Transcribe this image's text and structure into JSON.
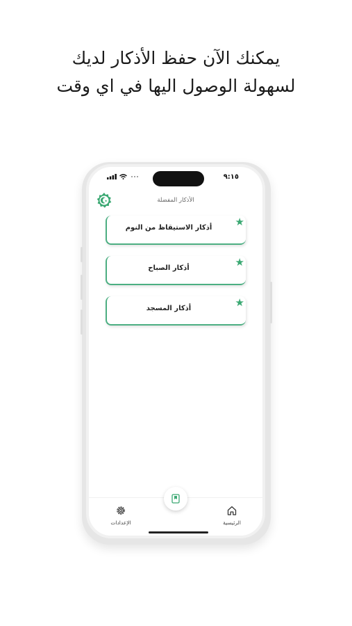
{
  "headline": {
    "line1": "يمكنك الآن حفظ الأذكار لديك",
    "line2": "لسهولة الوصول اليها في اي وقت"
  },
  "status_bar": {
    "time": "٩:١٥"
  },
  "screen": {
    "title": "الأذكار المفضلة"
  },
  "favorites": [
    {
      "label": "أذكار الاستيقاظ من النوم"
    },
    {
      "label": "أذكار الصباح"
    },
    {
      "label": "أذكار المسجد"
    }
  ],
  "bottom_nav": {
    "home_label": "الرئيسية",
    "settings_label": "الإعدادات"
  },
  "colors": {
    "accent": "#3aa872",
    "card_border": "#4caf82"
  }
}
